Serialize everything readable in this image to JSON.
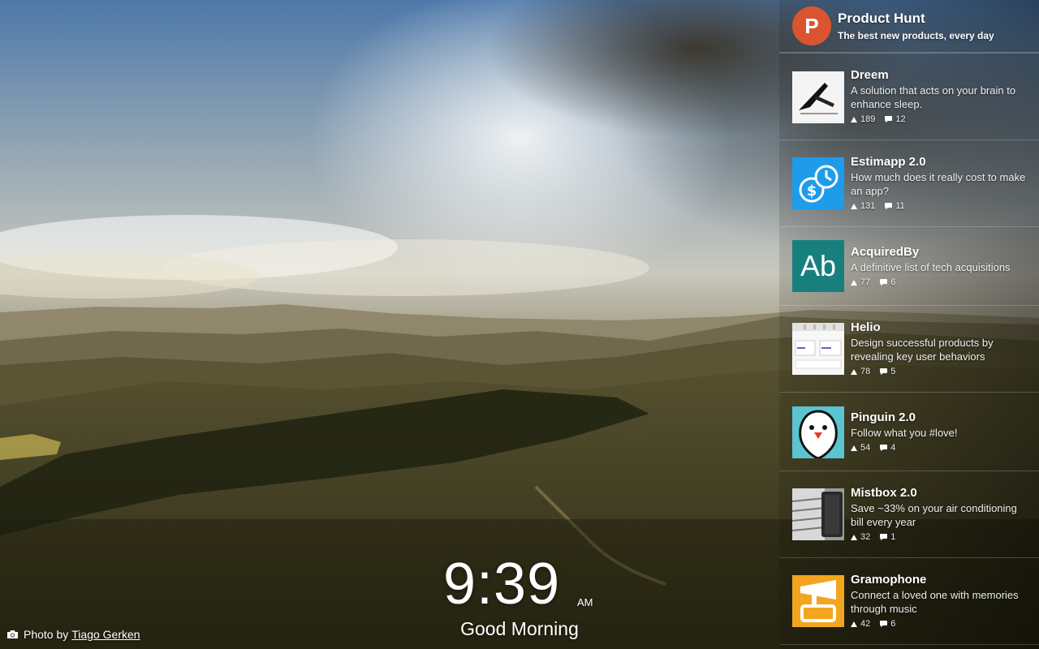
{
  "header": {
    "logo_letter": "P",
    "title": "Product Hunt",
    "tagline": "The best new products, every day"
  },
  "posts": [
    {
      "name": "Dreem",
      "description": "A solution that acts on your brain to enhance sleep.",
      "votes": "189",
      "comments": "12",
      "icon": "dreem-logo-icon"
    },
    {
      "name": "Estimapp 2.0",
      "description": "How much does it really cost to make an app?",
      "votes": "131",
      "comments": "11",
      "icon": "estimapp-logo-icon"
    },
    {
      "name": "AcquiredBy",
      "description": "A definitive list of tech acquisitions",
      "votes": "77",
      "comments": "6",
      "icon": "acquiredby-logo-icon",
      "logo_text": "Ab"
    },
    {
      "name": "Helio",
      "description": "Design successful products by revealing key user behaviors",
      "votes": "78",
      "comments": "5",
      "icon": "helio-screenshot-icon"
    },
    {
      "name": "Pinguin 2.0",
      "description": "Follow what you #love!",
      "votes": "54",
      "comments": "4",
      "icon": "pinguin-logo-icon"
    },
    {
      "name": "Mistbox 2.0",
      "description": "Save ~33% on your air conditioning bill every year",
      "votes": "32",
      "comments": "1",
      "icon": "mistbox-photo-icon"
    },
    {
      "name": "Gramophone",
      "description": "Connect a loved one with memories through music",
      "votes": "42",
      "comments": "6",
      "icon": "gramophone-logo-icon"
    }
  ],
  "clock": {
    "time": "9:39",
    "period": "AM"
  },
  "greeting": "Good Morning",
  "credit": {
    "prefix": "Photo by",
    "author": "Tiago Gerken"
  },
  "colors": {
    "brand": "#da552f",
    "estimapp": "#1e9be9",
    "acquiredby": "#17807f",
    "pinguin": "#5cc3d0",
    "gramophone": "#f3a51f"
  }
}
